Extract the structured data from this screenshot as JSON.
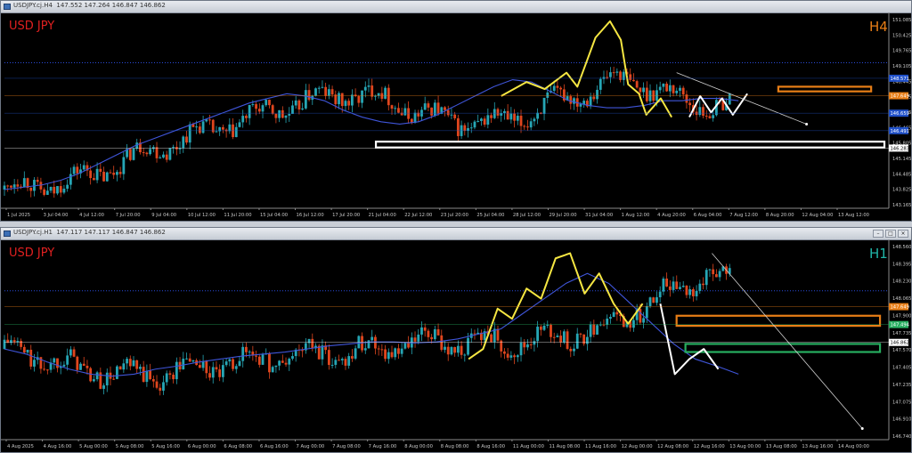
{
  "colors": {
    "background": "#000000",
    "bull_candle": "#26a6b5",
    "bear_candle": "#e0461e",
    "ma_line": "#3f55d9",
    "projection": "#f5e642",
    "projection_future": "#ffffff",
    "symbol_label": "#e02020",
    "timeframe_h4": "#e87e16",
    "timeframe_h1": "#20b5a8",
    "zone_orange": "#e87e16",
    "zone_white": "#ffffff",
    "zone_green": "#27ae60",
    "axis_text": "#c8c8c8"
  },
  "charts": [
    {
      "window_title": "USDJPY.cj.H4",
      "title_prices": "147.552 147.264 146.847 146.862",
      "symbol_label": "USD JPY",
      "timeframe": "H4",
      "price_axis": [
        "151.085",
        "150.425",
        "149.765",
        "149.105",
        "148.445",
        "147.785",
        "147.125",
        "146.465",
        "145.805",
        "145.145",
        "144.485",
        "143.825",
        "143.165"
      ],
      "price_badges": [
        {
          "text": "148.571",
          "color": "#2050c8"
        },
        {
          "text": "147.649",
          "color": "#e87e16"
        },
        {
          "text": "146.659",
          "color": "#2050c8"
        },
        {
          "text": "146.491",
          "color": "#2050c8"
        },
        {
          "text": "146.283",
          "color": "#ffffff"
        }
      ],
      "time_axis": [
        "1 Jul 2025",
        "3 Jul 04:00",
        "4 Jul 12:00",
        "7 Jul 20:00",
        "9 Jul 04:00",
        "10 Jul 12:00",
        "11 Jul 20:00",
        "15 Jul 04:00",
        "16 Jul 12:00",
        "17 Jul 20:00",
        "21 Jul 04:00",
        "22 Jul 12:00",
        "23 Jul 20:00",
        "25 Jul 04:00",
        "28 Jul 12:00",
        "29 Jul 20:00",
        "31 Jul 04:00",
        "1 Aug 12:00",
        "4 Aug 20:00",
        "6 Aug 04:00",
        "7 Aug 12:00",
        "8 Aug 20:00",
        "12 Aug 04:00",
        "13 Aug 12:00"
      ]
    },
    {
      "window_title": "USDJPY.cj.H1",
      "title_prices": "147.117 147.117 146.847 146.862",
      "symbol_label": "USD JPY",
      "timeframe": "H1",
      "price_axis": [
        "148.560",
        "148.395",
        "148.230",
        "148.065",
        "147.900",
        "147.735",
        "147.570",
        "147.405",
        "147.235",
        "147.075",
        "146.910",
        "146.740"
      ],
      "price_badges": [
        {
          "text": "147.649",
          "color": "#e87e16"
        },
        {
          "text": "147.494",
          "color": "#27ae60"
        },
        {
          "text": "146.862",
          "color": "#ffffff"
        }
      ],
      "time_axis": [
        "4 Aug 2025",
        "4 Aug 16:00",
        "5 Aug 00:00",
        "5 Aug 08:00",
        "5 Aug 16:00",
        "6 Aug 00:00",
        "6 Aug 08:00",
        "6 Aug 16:00",
        "7 Aug 00:00",
        "7 Aug 08:00",
        "7 Aug 16:00",
        "8 Aug 00:00",
        "8 Aug 08:00",
        "8 Aug 16:00",
        "11 Aug 00:00",
        "11 Aug 08:00",
        "11 Aug 16:00",
        "12 Aug 00:00",
        "12 Aug 08:00",
        "12 Aug 16:00",
        "13 Aug 00:00",
        "13 Aug 08:00",
        "13 Aug 16:00",
        "14 Aug 00:00"
      ]
    }
  ],
  "chart_data": [
    {
      "type": "candlestick",
      "symbol": "USDJPY",
      "timeframe": "H4",
      "ylim": [
        143.0,
        151.3
      ],
      "ma": [
        143.8,
        143.9,
        144.0,
        144.2,
        144.5,
        144.9,
        145.3,
        145.7,
        146.0,
        146.3,
        146.6,
        146.9,
        147.2,
        147.5,
        147.7,
        147.9,
        147.8,
        147.6,
        147.2,
        146.9,
        146.7,
        146.6,
        146.7,
        147.0,
        147.4,
        147.8,
        148.2,
        148.5,
        148.4,
        148.0,
        147.6,
        147.4,
        147.3,
        147.3,
        147.4,
        147.6,
        147.6,
        147.7,
        147.7,
        147.6
      ],
      "ma_x": [
        0,
        0.026,
        0.052,
        0.078,
        0.104,
        0.13,
        0.156,
        0.182,
        0.208,
        0.234,
        0.26,
        0.286,
        0.312,
        0.338,
        0.364,
        0.39,
        0.416,
        0.442,
        0.468,
        0.494,
        0.52,
        0.546,
        0.572,
        0.598,
        0.624,
        0.65,
        0.676,
        0.702,
        0.728,
        0.754,
        0.78,
        0.806,
        0.832,
        0.858,
        0.884,
        0.91,
        0.936,
        0.962,
        0.988,
        1.0
      ],
      "projection": [
        [
          0.685,
          147.8
        ],
        [
          0.72,
          148.4
        ],
        [
          0.745,
          148.1
        ],
        [
          0.775,
          148.8
        ],
        [
          0.79,
          148.2
        ],
        [
          0.815,
          150.3
        ],
        [
          0.835,
          151.0
        ],
        [
          0.85,
          150.2
        ],
        [
          0.86,
          148.3
        ],
        [
          0.875,
          147.9
        ],
        [
          0.885,
          147.0
        ],
        [
          0.905,
          147.7
        ],
        [
          0.92,
          146.9
        ],
        [
          0.935,
          147.8
        ],
        [
          0.95,
          147.1
        ],
        [
          0.965,
          147.7
        ],
        [
          0.98,
          147.0
        ],
        [
          1.0,
          147.9
        ]
      ],
      "trendline": [
        [
          0.76,
          148.8
        ],
        [
          0.935,
          146.6
        ]
      ],
      "zones": [
        {
          "color": "orange",
          "y": [
            148.0,
            148.2
          ],
          "x": [
            0.875,
            0.98
          ]
        },
        {
          "color": "white",
          "y": [
            145.6,
            145.85
          ],
          "x": [
            0.42,
            0.995
          ]
        }
      ]
    },
    {
      "type": "candlestick",
      "symbol": "USDJPY",
      "timeframe": "H1",
      "ylim": [
        146.65,
        148.62
      ],
      "ma": [
        147.55,
        147.5,
        147.42,
        147.35,
        147.3,
        147.28,
        147.3,
        147.35,
        147.38,
        147.42,
        147.45,
        147.48,
        147.5,
        147.52,
        147.55,
        147.58,
        147.6,
        147.62,
        147.62,
        147.61,
        147.62,
        147.65,
        147.7,
        147.75,
        147.9,
        148.05,
        148.2,
        148.3,
        148.2,
        148.0,
        147.8,
        147.6,
        147.45,
        147.38,
        147.3
      ],
      "projection": [
        [
          0.64,
          147.45
        ],
        [
          0.66,
          147.55
        ],
        [
          0.68,
          147.95
        ],
        [
          0.7,
          147.85
        ],
        [
          0.72,
          148.15
        ],
        [
          0.74,
          148.05
        ],
        [
          0.76,
          148.45
        ],
        [
          0.78,
          148.5
        ],
        [
          0.8,
          148.1
        ],
        [
          0.82,
          148.3
        ],
        [
          0.84,
          148.0
        ],
        [
          0.86,
          147.8
        ],
        [
          0.88,
          148.0
        ],
        [
          0.9,
          147.3
        ],
        [
          0.92,
          147.45
        ],
        [
          0.94,
          147.55
        ],
        [
          0.96,
          147.35
        ]
      ],
      "trendline": [
        [
          0.8,
          148.5
        ],
        [
          1.0,
          146.76
        ]
      ],
      "zones": [
        {
          "color": "orange",
          "y": [
            147.78,
            147.88
          ],
          "x": [
            0.76,
            0.99
          ]
        },
        {
          "color": "green",
          "y": [
            147.52,
            147.6
          ],
          "x": [
            0.77,
            0.99
          ]
        }
      ]
    }
  ]
}
